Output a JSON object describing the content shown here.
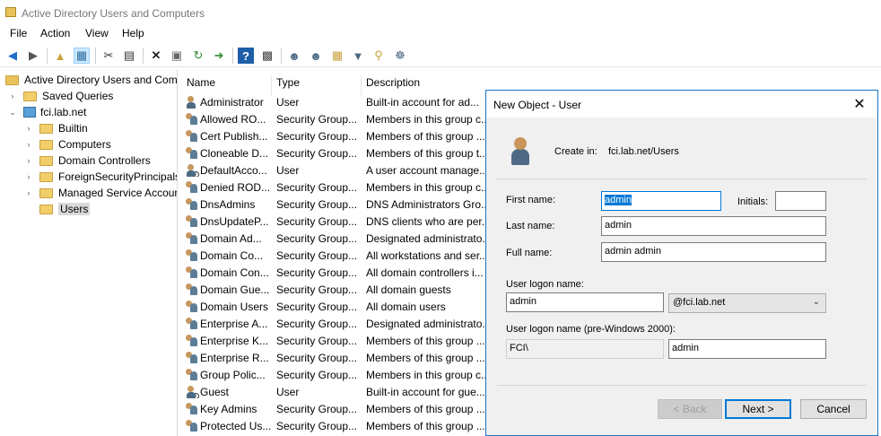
{
  "window": {
    "title": "Active Directory Users and Computers"
  },
  "menu": [
    "File",
    "Action",
    "View",
    "Help"
  ],
  "toolbar_icons": [
    "back-arrow-icon",
    "forward-arrow-icon",
    "up-folder-icon",
    "show-tree-icon",
    "cut-icon",
    "copy-icon",
    "delete-icon",
    "properties-icon",
    "refresh-icon",
    "export-list-icon",
    "help-icon",
    "mmc-view-icon",
    "new-user-icon",
    "new-group-icon",
    "new-ou-icon",
    "filter-icon",
    "find-icon",
    "delegate-icon"
  ],
  "tree": {
    "root": "Active Directory Users and Com",
    "items": [
      {
        "label": "Saved Queries"
      },
      {
        "label": "fci.lab.net"
      },
      {
        "label": "Builtin"
      },
      {
        "label": "Computers"
      },
      {
        "label": "Domain Controllers"
      },
      {
        "label": "ForeignSecurityPrincipals"
      },
      {
        "label": "Managed Service Accour"
      },
      {
        "label": "Users"
      }
    ]
  },
  "list": {
    "headers": {
      "name": "Name",
      "type": "Type",
      "description": "Description"
    },
    "rows": [
      {
        "name": "Administrator",
        "type": "User",
        "description": "Built-in account for ad...",
        "icon": "user"
      },
      {
        "name": "Allowed RO...",
        "type": "Security Group...",
        "description": "Members in this group c...",
        "icon": "group"
      },
      {
        "name": "Cert Publish...",
        "type": "Security Group...",
        "description": "Members of this group ...",
        "icon": "group"
      },
      {
        "name": "Cloneable D...",
        "type": "Security Group...",
        "description": "Members of this group t...",
        "icon": "group"
      },
      {
        "name": "DefaultAcco...",
        "type": "User",
        "description": "A user account manage...",
        "icon": "disabled-user"
      },
      {
        "name": "Denied ROD...",
        "type": "Security Group...",
        "description": "Members in this group c...",
        "icon": "group"
      },
      {
        "name": "DnsAdmins",
        "type": "Security Group...",
        "description": "DNS Administrators Gro...",
        "icon": "group"
      },
      {
        "name": "DnsUpdateP...",
        "type": "Security Group...",
        "description": "DNS clients who are per...",
        "icon": "group"
      },
      {
        "name": "Domain Ad...",
        "type": "Security Group...",
        "description": "Designated administrato...",
        "icon": "group"
      },
      {
        "name": "Domain Co...",
        "type": "Security Group...",
        "description": "All workstations and ser...",
        "icon": "group"
      },
      {
        "name": "Domain Con...",
        "type": "Security Group...",
        "description": "All domain controllers i...",
        "icon": "group"
      },
      {
        "name": "Domain Gue...",
        "type": "Security Group...",
        "description": "All domain guests",
        "icon": "group"
      },
      {
        "name": "Domain Users",
        "type": "Security Group...",
        "description": "All domain users",
        "icon": "group"
      },
      {
        "name": "Enterprise A...",
        "type": "Security Group...",
        "description": "Designated administrato...",
        "icon": "group"
      },
      {
        "name": "Enterprise K...",
        "type": "Security Group...",
        "description": "Members of this group ...",
        "icon": "group"
      },
      {
        "name": "Enterprise R...",
        "type": "Security Group...",
        "description": "Members of this group ...",
        "icon": "group"
      },
      {
        "name": "Group Polic...",
        "type": "Security Group...",
        "description": "Members in this group c...",
        "icon": "group"
      },
      {
        "name": "Guest",
        "type": "User",
        "description": "Built-in account for gue...",
        "icon": "disabled-user"
      },
      {
        "name": "Key Admins",
        "type": "Security Group...",
        "description": "Members of this group ...",
        "icon": "group"
      },
      {
        "name": "Protected Us...",
        "type": "Security Group...",
        "description": "Members of this group ...",
        "icon": "group"
      }
    ]
  },
  "dialog": {
    "title": "New Object - User",
    "create_in_label": "Create in:",
    "create_in_value": "fci.lab.net/Users",
    "first_name_label": "First name:",
    "first_name_value": "admin",
    "initials_label": "Initials:",
    "initials_value": "",
    "last_name_label": "Last name:",
    "last_name_value": "admin",
    "full_name_label": "Full name:",
    "full_name_value": "admin admin",
    "logon_name_label": "User logon name:",
    "logon_name_value": "admin",
    "upn_suffix": "@fci.lab.net",
    "pre2000_label": "User logon name (pre-Windows 2000):",
    "pre2000_domain": "FCI\\",
    "pre2000_value": "admin",
    "back_label": "< Back",
    "next_label": "Next >",
    "cancel_label": "Cancel",
    "close_glyph": "✕"
  }
}
